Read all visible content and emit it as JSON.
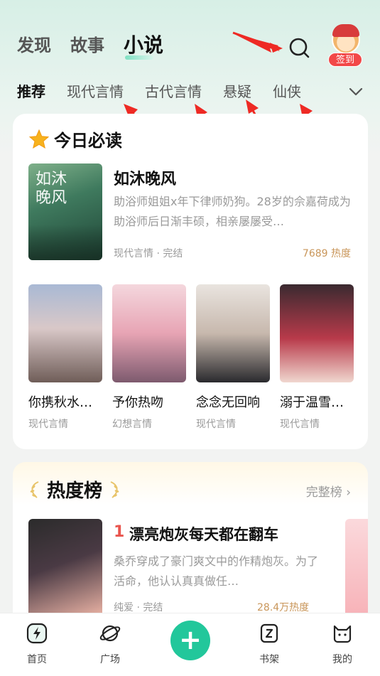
{
  "top_tabs": [
    "发现",
    "故事",
    "小说"
  ],
  "active_top_tab": "小说",
  "sign_badge": "签到",
  "categories": [
    "推荐",
    "现代言情",
    "古代言情",
    "悬疑",
    "仙侠"
  ],
  "today_section": {
    "title": "今日必读",
    "featured": {
      "title": "如沐晚风",
      "description": "助浴师姐姐x年下律师奶狗。28岁的佘嘉荷成为助浴师后日渐丰硕，相亲屡屡受…",
      "meta": "现代言情 · 完结",
      "heat": "7689 热度",
      "cover_text": "如沐晚风"
    },
    "books": [
      {
        "title": "你携秋水…",
        "category": "现代言情"
      },
      {
        "title": "予你热吻",
        "category": "幻想言情"
      },
      {
        "title": "念念无回响",
        "category": "现代言情"
      },
      {
        "title": "溺于温雪…",
        "category": "现代言情"
      }
    ]
  },
  "ranking": {
    "title": "热度榜",
    "more": "完整榜 ›",
    "top": {
      "rank": "1",
      "title": "漂亮炮灰每天都在翻车",
      "description": "桑乔穿成了豪门爽文中的作精炮灰。为了活命，他认认真真做任…",
      "meta": "纯爱 · 完结",
      "heat": "28.4万热度"
    }
  },
  "bottom_nav": [
    {
      "label": "首页",
      "icon": "home-icon"
    },
    {
      "label": "广场",
      "icon": "planet-icon"
    },
    {
      "label": "书架",
      "icon": "bookshelf-icon"
    },
    {
      "label": "我的",
      "icon": "profile-icon"
    }
  ],
  "colors": {
    "accent": "#22c79b",
    "heat": "#c9965a",
    "rank_red": "#e9554e",
    "annotation_arrow": "#ee2a24"
  }
}
